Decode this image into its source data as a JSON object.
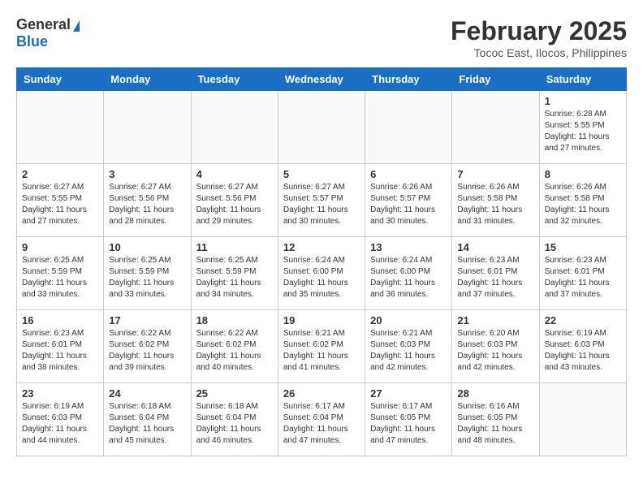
{
  "logo": {
    "general": "General",
    "blue": "Blue"
  },
  "title": "February 2025",
  "location": "Tococ East, Ilocos, Philippines",
  "days_of_week": [
    "Sunday",
    "Monday",
    "Tuesday",
    "Wednesday",
    "Thursday",
    "Friday",
    "Saturday"
  ],
  "weeks": [
    [
      {
        "day": "",
        "info": ""
      },
      {
        "day": "",
        "info": ""
      },
      {
        "day": "",
        "info": ""
      },
      {
        "day": "",
        "info": ""
      },
      {
        "day": "",
        "info": ""
      },
      {
        "day": "",
        "info": ""
      },
      {
        "day": "1",
        "info": "Sunrise: 6:28 AM\nSunset: 5:55 PM\nDaylight: 11 hours and 27 minutes."
      }
    ],
    [
      {
        "day": "2",
        "info": "Sunrise: 6:27 AM\nSunset: 5:55 PM\nDaylight: 11 hours and 27 minutes."
      },
      {
        "day": "3",
        "info": "Sunrise: 6:27 AM\nSunset: 5:56 PM\nDaylight: 11 hours and 28 minutes."
      },
      {
        "day": "4",
        "info": "Sunrise: 6:27 AM\nSunset: 5:56 PM\nDaylight: 11 hours and 29 minutes."
      },
      {
        "day": "5",
        "info": "Sunrise: 6:27 AM\nSunset: 5:57 PM\nDaylight: 11 hours and 30 minutes."
      },
      {
        "day": "6",
        "info": "Sunrise: 6:26 AM\nSunset: 5:57 PM\nDaylight: 11 hours and 30 minutes."
      },
      {
        "day": "7",
        "info": "Sunrise: 6:26 AM\nSunset: 5:58 PM\nDaylight: 11 hours and 31 minutes."
      },
      {
        "day": "8",
        "info": "Sunrise: 6:26 AM\nSunset: 5:58 PM\nDaylight: 11 hours and 32 minutes."
      }
    ],
    [
      {
        "day": "9",
        "info": "Sunrise: 6:25 AM\nSunset: 5:59 PM\nDaylight: 11 hours and 33 minutes."
      },
      {
        "day": "10",
        "info": "Sunrise: 6:25 AM\nSunset: 5:59 PM\nDaylight: 11 hours and 33 minutes."
      },
      {
        "day": "11",
        "info": "Sunrise: 6:25 AM\nSunset: 5:59 PM\nDaylight: 11 hours and 34 minutes."
      },
      {
        "day": "12",
        "info": "Sunrise: 6:24 AM\nSunset: 6:00 PM\nDaylight: 11 hours and 35 minutes."
      },
      {
        "day": "13",
        "info": "Sunrise: 6:24 AM\nSunset: 6:00 PM\nDaylight: 11 hours and 36 minutes."
      },
      {
        "day": "14",
        "info": "Sunrise: 6:23 AM\nSunset: 6:01 PM\nDaylight: 11 hours and 37 minutes."
      },
      {
        "day": "15",
        "info": "Sunrise: 6:23 AM\nSunset: 6:01 PM\nDaylight: 11 hours and 37 minutes."
      }
    ],
    [
      {
        "day": "16",
        "info": "Sunrise: 6:23 AM\nSunset: 6:01 PM\nDaylight: 11 hours and 38 minutes."
      },
      {
        "day": "17",
        "info": "Sunrise: 6:22 AM\nSunset: 6:02 PM\nDaylight: 11 hours and 39 minutes."
      },
      {
        "day": "18",
        "info": "Sunrise: 6:22 AM\nSunset: 6:02 PM\nDaylight: 11 hours and 40 minutes."
      },
      {
        "day": "19",
        "info": "Sunrise: 6:21 AM\nSunset: 6:02 PM\nDaylight: 11 hours and 41 minutes."
      },
      {
        "day": "20",
        "info": "Sunrise: 6:21 AM\nSunset: 6:03 PM\nDaylight: 11 hours and 42 minutes."
      },
      {
        "day": "21",
        "info": "Sunrise: 6:20 AM\nSunset: 6:03 PM\nDaylight: 11 hours and 42 minutes."
      },
      {
        "day": "22",
        "info": "Sunrise: 6:19 AM\nSunset: 6:03 PM\nDaylight: 11 hours and 43 minutes."
      }
    ],
    [
      {
        "day": "23",
        "info": "Sunrise: 6:19 AM\nSunset: 6:03 PM\nDaylight: 11 hours and 44 minutes."
      },
      {
        "day": "24",
        "info": "Sunrise: 6:18 AM\nSunset: 6:04 PM\nDaylight: 11 hours and 45 minutes."
      },
      {
        "day": "25",
        "info": "Sunrise: 6:18 AM\nSunset: 6:04 PM\nDaylight: 11 hours and 46 minutes."
      },
      {
        "day": "26",
        "info": "Sunrise: 6:17 AM\nSunset: 6:04 PM\nDaylight: 11 hours and 47 minutes."
      },
      {
        "day": "27",
        "info": "Sunrise: 6:17 AM\nSunset: 6:05 PM\nDaylight: 11 hours and 47 minutes."
      },
      {
        "day": "28",
        "info": "Sunrise: 6:16 AM\nSunset: 6:05 PM\nDaylight: 11 hours and 48 minutes."
      },
      {
        "day": "",
        "info": ""
      }
    ]
  ]
}
